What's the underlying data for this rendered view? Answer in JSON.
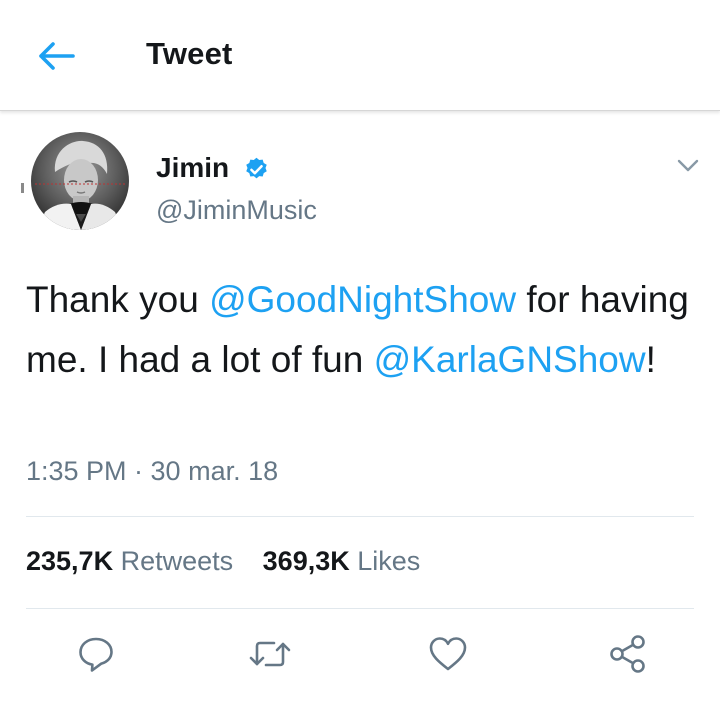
{
  "header": {
    "title": "Tweet",
    "back_icon": "arrow-left-icon",
    "accent_color": "#1da1f2"
  },
  "author": {
    "name": "Jimin",
    "handle": "@JiminMusic",
    "verified": true,
    "verified_icon": "verified-badge-icon",
    "menu_icon": "chevron-down-icon"
  },
  "tweet": {
    "text_part_1": "Thank you ",
    "mention_1": "@GoodNightShow",
    "text_part_2": " for having me. I had a lot of fun ",
    "mention_2": "@KarlaGNShow",
    "text_part_3": "!",
    "timestamp": "1:35 PM · 30 mar. 18"
  },
  "stats": {
    "retweets_count": "235,7K",
    "retweets_label": " Retweets",
    "likes_count": "369,3K",
    "likes_label": " Likes"
  },
  "actions": [
    {
      "name": "reply",
      "icon": "reply-icon"
    },
    {
      "name": "retweet",
      "icon": "retweet-icon"
    },
    {
      "name": "like",
      "icon": "heart-icon"
    },
    {
      "name": "share",
      "icon": "share-icon"
    }
  ],
  "colors": {
    "text_primary": "#14171a",
    "text_secondary": "#657786",
    "link": "#1da1f2",
    "verified": "#1da1f2"
  }
}
